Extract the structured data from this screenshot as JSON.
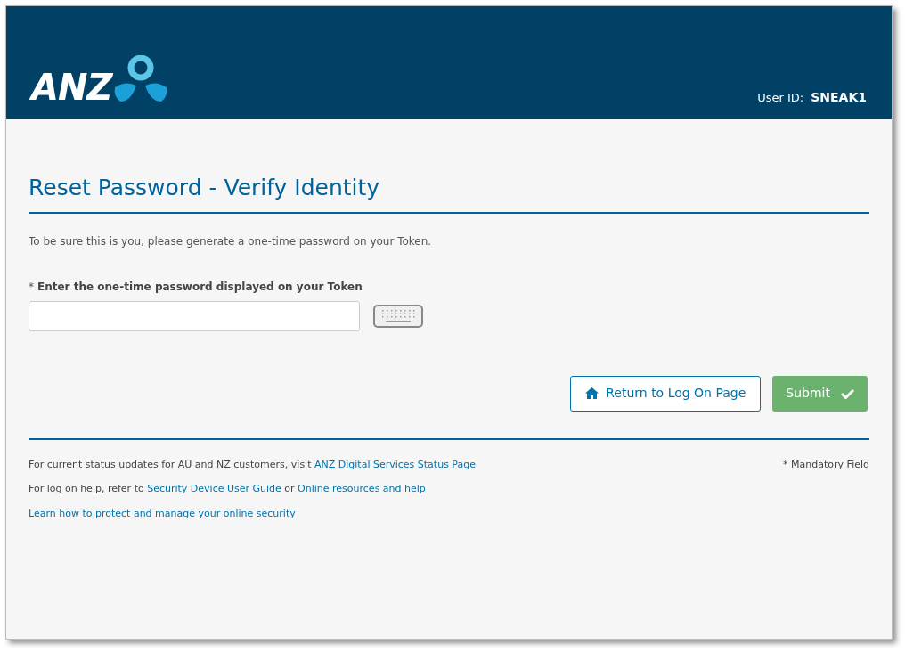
{
  "header": {
    "logo_text": "ANZ",
    "user_id_label": "User ID:",
    "user_id": "SNEAK1"
  },
  "title": "Reset Password - Verify Identity",
  "intro": "To be sure this is you, please generate a one-time password on your Token.",
  "field": {
    "required_mark": "*",
    "label": "Enter the one-time password displayed on your Token"
  },
  "buttons": [
    {
      "kind": "secondary",
      "label": "Return to Log On Page"
    },
    {
      "kind": "primary",
      "label": "Submit"
    }
  ],
  "footer": {
    "lines": [
      {
        "parts": [
          {
            "kind": "text",
            "text": "For current status updates for AU and NZ customers, visit "
          },
          {
            "kind": "link",
            "text": "ANZ Digital Services Status Page"
          }
        ]
      },
      {
        "parts": [
          {
            "kind": "text",
            "text": "For log on help, refer to "
          },
          {
            "kind": "link",
            "text": "Security Device User Guide"
          },
          {
            "kind": "text",
            "text": " or "
          },
          {
            "kind": "link",
            "text": "Online resources and help"
          }
        ]
      },
      {
        "parts": [
          {
            "kind": "link",
            "text": "Learn how to protect and manage your online security"
          }
        ]
      }
    ],
    "mandatory_note": "* Mandatory Field"
  }
}
